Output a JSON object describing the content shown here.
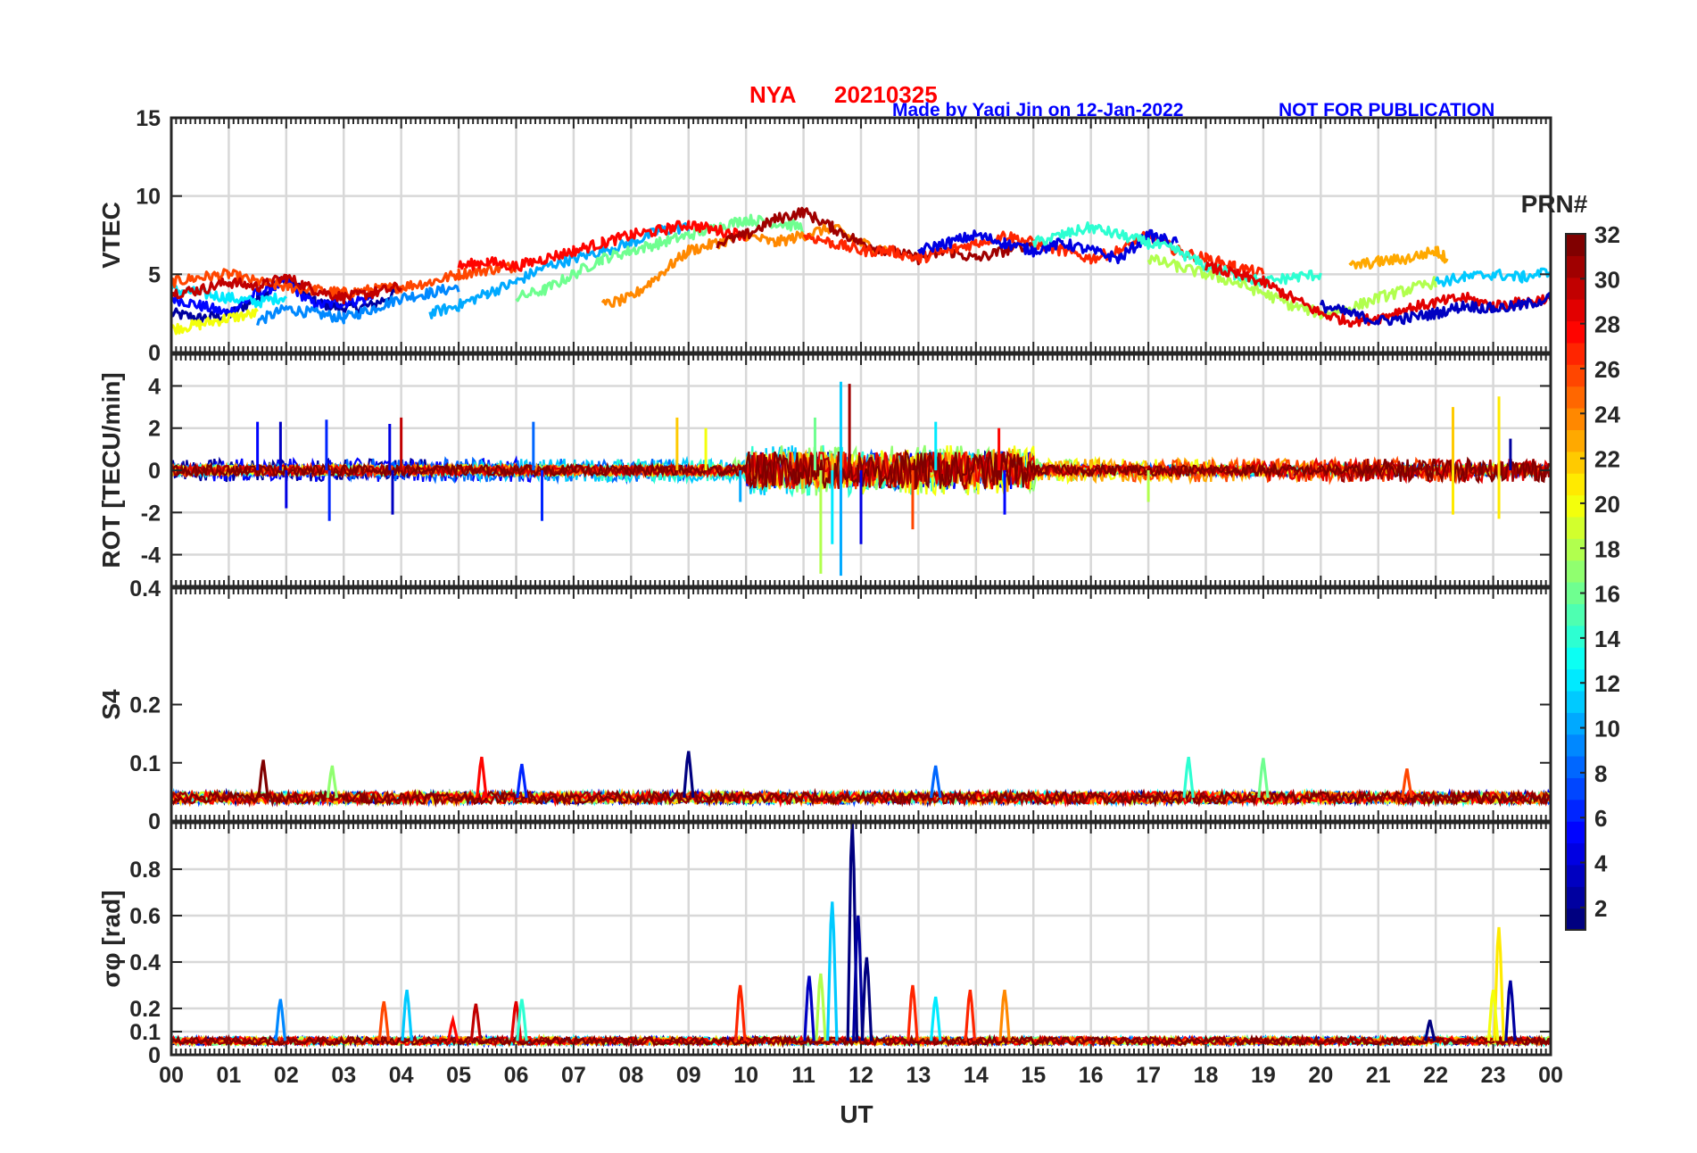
{
  "header": {
    "station": "NYA",
    "date": "20210325",
    "credit": "Made by Yaqi Jin on 12-Jan-2022",
    "notice": "NOT FOR PUBLICATION",
    "station_color": "#ff0000",
    "credit_color": "#0000ff"
  },
  "chart_data": [
    {
      "type": "line",
      "panel": "vtec",
      "ylabel": "VTEC",
      "ylim": [
        0,
        15
      ],
      "yticks": [
        0,
        5,
        10,
        15
      ],
      "ytick_labels": [
        "0",
        "5",
        "10",
        "15"
      ],
      "xlim": [
        0,
        24
      ],
      "grid": true,
      "series_note_values": "approximate envelope traces per PRN group",
      "series": [
        {
          "prn": 2,
          "x": [
            0,
            0.5,
            1,
            1.5,
            2,
            2.5,
            3,
            3.5,
            4
          ],
          "y": [
            2.5,
            2.2,
            2.4,
            3.5,
            4.8,
            3.2,
            2.8,
            3.0,
            4.0
          ]
        },
        {
          "prn": 5,
          "x": [
            0,
            0.5,
            1,
            1.5,
            2,
            2.5,
            3,
            3.5
          ],
          "y": [
            3.5,
            3.0,
            2.5,
            3.8,
            4.5,
            3.0,
            3.2,
            3.5
          ]
        },
        {
          "prn": 9,
          "x": [
            1.5,
            2,
            2.5,
            3,
            3.5,
            4,
            4.5,
            5
          ],
          "y": [
            2.0,
            2.8,
            2.5,
            2.2,
            2.8,
            3.5,
            3.8,
            4.2
          ]
        },
        {
          "prn": 12,
          "x": [
            0,
            0.5,
            1,
            1.5,
            2
          ],
          "y": [
            4.0,
            3.8,
            3.5,
            3.2,
            3.6
          ]
        },
        {
          "prn": 20,
          "x": [
            0,
            0.5,
            1,
            1.5
          ],
          "y": [
            1.5,
            1.8,
            2.2,
            2.5
          ]
        },
        {
          "prn": 26,
          "x": [
            0,
            0.5,
            1,
            1.5,
            2,
            2.5,
            3,
            3.5,
            4,
            4.5,
            5,
            5.5,
            6
          ],
          "y": [
            4.5,
            4.8,
            5.0,
            4.5,
            4.2,
            4.0,
            3.8,
            4.0,
            4.2,
            4.5,
            5.0,
            5.3,
            5.5
          ]
        },
        {
          "prn": 30,
          "x": [
            0,
            0.5,
            1,
            1.5,
            2,
            2.5,
            3,
            3.5,
            4
          ],
          "y": [
            3.8,
            4.0,
            4.5,
            4.2,
            4.8,
            4.0,
            3.5,
            3.8,
            4.2
          ]
        },
        {
          "prn": 10,
          "x": [
            4.5,
            5,
            5.5,
            6,
            6.5,
            7,
            7.5,
            8,
            8.5,
            9
          ],
          "y": [
            2.5,
            3.0,
            3.8,
            4.5,
            5.5,
            6.0,
            6.5,
            7.0,
            7.8,
            8.0
          ]
        },
        {
          "prn": 16,
          "x": [
            6,
            6.5,
            7,
            7.5,
            8,
            8.5,
            9,
            9.5,
            10,
            10.5,
            11
          ],
          "y": [
            3.5,
            4.0,
            5.0,
            6.0,
            6.5,
            7.0,
            7.5,
            8.0,
            8.5,
            8.3,
            8.0
          ]
        },
        {
          "prn": 24,
          "x": [
            7.5,
            8,
            8.5,
            9,
            9.5,
            10,
            10.5,
            11,
            11.5,
            12,
            12.5
          ],
          "y": [
            3.0,
            3.5,
            5.0,
            6.5,
            7.0,
            7.5,
            7.0,
            7.5,
            8.0,
            7.0,
            6.5
          ]
        },
        {
          "prn": 28,
          "x": [
            5,
            5.5,
            6,
            6.5,
            7,
            7.5,
            8,
            8.5,
            9,
            9.5,
            10
          ],
          "y": [
            5.5,
            5.8,
            5.5,
            6.0,
            6.5,
            7.0,
            7.5,
            7.8,
            8.2,
            7.8,
            7.5
          ]
        },
        {
          "prn": 31,
          "x": [
            9.5,
            10,
            10.5,
            11,
            11.5,
            12,
            12.5,
            13,
            13.5,
            14,
            14.5,
            15
          ],
          "y": [
            7.0,
            7.5,
            8.5,
            9.0,
            8.0,
            7.0,
            6.5,
            6.0,
            6.5,
            6.0,
            6.5,
            7.0
          ]
        },
        {
          "prn": 27,
          "x": [
            11,
            11.5,
            12,
            12.5,
            13,
            13.5,
            14,
            14.5,
            15,
            15.5,
            16,
            16.5,
            17,
            17.5,
            18,
            18.5,
            19
          ],
          "y": [
            7.5,
            7.0,
            6.5,
            6.5,
            6.0,
            6.5,
            7.0,
            7.5,
            7.0,
            6.5,
            6.0,
            6.5,
            7.5,
            6.5,
            6.0,
            5.5,
            5.0
          ]
        },
        {
          "prn": 4,
          "x": [
            13,
            13.5,
            14,
            14.5,
            15,
            15.5,
            16,
            16.5,
            17,
            17.5
          ],
          "y": [
            6.5,
            7.0,
            7.5,
            7.0,
            6.5,
            7.0,
            6.5,
            6.0,
            7.5,
            7.0
          ]
        },
        {
          "prn": 14,
          "x": [
            15,
            15.5,
            16,
            16.5,
            17,
            17.5,
            18,
            18.5,
            19,
            19.5,
            20
          ],
          "y": [
            7.0,
            7.5,
            8.0,
            7.5,
            7.0,
            6.5,
            5.5,
            5.0,
            4.5,
            4.8,
            5.0
          ]
        },
        {
          "prn": 18,
          "x": [
            17,
            17.5,
            18,
            18.5,
            19,
            19.5,
            20,
            20.5,
            21,
            21.5,
            22
          ],
          "y": [
            6.0,
            5.5,
            5.0,
            4.5,
            3.8,
            3.0,
            2.5,
            2.8,
            3.5,
            4.0,
            4.5
          ]
        },
        {
          "prn": 29,
          "x": [
            18,
            18.5,
            19,
            19.5,
            20,
            20.5,
            21,
            21.5,
            22,
            22.5,
            23,
            23.5,
            24
          ],
          "y": [
            5.5,
            5.0,
            4.5,
            3.5,
            2.5,
            2.0,
            2.2,
            2.8,
            3.2,
            3.5,
            3.0,
            3.2,
            3.5
          ]
        },
        {
          "prn": 3,
          "x": [
            20,
            20.5,
            21,
            21.5,
            22,
            22.5,
            23,
            23.5,
            24
          ],
          "y": [
            3.0,
            2.5,
            2.0,
            2.2,
            2.5,
            3.0,
            2.8,
            3.0,
            3.5
          ]
        },
        {
          "prn": 23,
          "x": [
            20.5,
            21,
            21.5,
            22,
            22.2
          ],
          "y": [
            5.5,
            5.8,
            6.0,
            6.5,
            6.0
          ]
        },
        {
          "prn": 11,
          "x": [
            22,
            22.5,
            23,
            23.5,
            24
          ],
          "y": [
            4.5,
            4.8,
            5.0,
            4.8,
            5.2
          ]
        }
      ]
    },
    {
      "type": "line",
      "panel": "rot",
      "ylabel": "ROT [TECU/min]",
      "ylim": [
        -5.5,
        5.5
      ],
      "yticks": [
        -4,
        -2,
        0,
        2,
        4
      ],
      "ytick_labels": [
        "-4",
        "-2",
        "0",
        "2",
        "4"
      ],
      "xlim": [
        0,
        24
      ],
      "grid": true,
      "spikes": [
        {
          "prn": 5,
          "x": 1.5,
          "y": 2.3
        },
        {
          "prn": 3,
          "x": 1.9,
          "y": 2.3
        },
        {
          "prn": 4,
          "x": 2.0,
          "y": -1.8
        },
        {
          "prn": 6,
          "x": 2.7,
          "y": 2.4
        },
        {
          "prn": 6,
          "x": 2.75,
          "y": -2.4
        },
        {
          "prn": 4,
          "x": 3.8,
          "y": 2.2
        },
        {
          "prn": 3,
          "x": 3.85,
          "y": -2.1
        },
        {
          "prn": 30,
          "x": 4.0,
          "y": 2.5
        },
        {
          "prn": 8,
          "x": 6.3,
          "y": 2.3
        },
        {
          "prn": 6,
          "x": 6.45,
          "y": -2.4
        },
        {
          "prn": 22,
          "x": 8.8,
          "y": 2.5
        },
        {
          "prn": 20,
          "x": 9.3,
          "y": 2.0
        },
        {
          "prn": 10,
          "x": 9.9,
          "y": -1.5
        },
        {
          "prn": 18,
          "x": 11.3,
          "y": -4.9
        },
        {
          "prn": 12,
          "x": 11.5,
          "y": -3.5
        },
        {
          "prn": 11,
          "x": 11.65,
          "y": 4.2
        },
        {
          "prn": 10,
          "x": 11.65,
          "y": -5.0
        },
        {
          "prn": 31,
          "x": 11.8,
          "y": 4.1
        },
        {
          "prn": 4,
          "x": 12.0,
          "y": -3.5
        },
        {
          "prn": 16,
          "x": 11.2,
          "y": 2.5
        },
        {
          "prn": 26,
          "x": 12.9,
          "y": -2.8
        },
        {
          "prn": 12,
          "x": 13.3,
          "y": 2.3
        },
        {
          "prn": 5,
          "x": 14.5,
          "y": -2.1
        },
        {
          "prn": 28,
          "x": 14.4,
          "y": 2.0
        },
        {
          "prn": 18,
          "x": 17.0,
          "y": -1.5
        },
        {
          "prn": 22,
          "x": 22.3,
          "y": 3.0
        },
        {
          "prn": 21,
          "x": 22.3,
          "y": -2.1
        },
        {
          "prn": 21,
          "x": 23.1,
          "y": 3.5
        },
        {
          "prn": 21,
          "x": 23.1,
          "y": -2.3
        },
        {
          "prn": 2,
          "x": 23.3,
          "y": 1.5
        }
      ]
    },
    {
      "type": "line",
      "panel": "s4",
      "ylabel": "S4",
      "ylim": [
        0,
        0.4
      ],
      "yticks": [
        0,
        0.1,
        0.2,
        0.4
      ],
      "ytick_labels": [
        "0",
        "0.1",
        "0.2",
        "0.4"
      ],
      "xlim": [
        0,
        24
      ],
      "grid": false,
      "baseline": 0.04,
      "peaks": [
        {
          "prn": 32,
          "x": 1.6,
          "y": 0.105
        },
        {
          "prn": 17,
          "x": 2.8,
          "y": 0.095
        },
        {
          "prn": 28,
          "x": 5.4,
          "y": 0.11
        },
        {
          "prn": 6,
          "x": 6.1,
          "y": 0.098
        },
        {
          "prn": 1,
          "x": 9.0,
          "y": 0.12
        },
        {
          "prn": 8,
          "x": 13.3,
          "y": 0.095
        },
        {
          "prn": 14,
          "x": 17.7,
          "y": 0.11
        },
        {
          "prn": 16,
          "x": 19.0,
          "y": 0.108
        },
        {
          "prn": 26,
          "x": 21.5,
          "y": 0.09
        }
      ]
    },
    {
      "type": "line",
      "panel": "sigma_phi",
      "ylabel": "σφ [rad]",
      "ylim": [
        0,
        1.0
      ],
      "yticks": [
        0,
        0.1,
        0.2,
        0.4,
        0.6,
        0.8
      ],
      "ytick_labels": [
        "0",
        "0.1",
        "0.2",
        "0.4",
        "0.6",
        "0.8"
      ],
      "xlim": [
        0,
        24
      ],
      "grid": true,
      "baseline": 0.06,
      "peaks": [
        {
          "prn": 9,
          "x": 1.9,
          "y": 0.24
        },
        {
          "prn": 26,
          "x": 3.7,
          "y": 0.23
        },
        {
          "prn": 11,
          "x": 4.1,
          "y": 0.28
        },
        {
          "prn": 28,
          "x": 4.9,
          "y": 0.15
        },
        {
          "prn": 30,
          "x": 5.3,
          "y": 0.22
        },
        {
          "prn": 29,
          "x": 6.0,
          "y": 0.23
        },
        {
          "prn": 14,
          "x": 6.1,
          "y": 0.24
        },
        {
          "prn": 27,
          "x": 9.9,
          "y": 0.3
        },
        {
          "prn": 18,
          "x": 11.3,
          "y": 0.35
        },
        {
          "prn": 3,
          "x": 11.1,
          "y": 0.34
        },
        {
          "prn": 11,
          "x": 11.5,
          "y": 0.66
        },
        {
          "prn": 1,
          "x": 11.85,
          "y": 1.0
        },
        {
          "prn": 2,
          "x": 11.95,
          "y": 0.6
        },
        {
          "prn": 1,
          "x": 12.1,
          "y": 0.42
        },
        {
          "prn": 27,
          "x": 12.9,
          "y": 0.3
        },
        {
          "prn": 12,
          "x": 13.3,
          "y": 0.25
        },
        {
          "prn": 27,
          "x": 13.9,
          "y": 0.28
        },
        {
          "prn": 24,
          "x": 14.5,
          "y": 0.28
        },
        {
          "prn": 21,
          "x": 23.1,
          "y": 0.55
        },
        {
          "prn": 20,
          "x": 23.0,
          "y": 0.28
        },
        {
          "prn": 2,
          "x": 23.3,
          "y": 0.32
        },
        {
          "prn": 1,
          "x": 21.9,
          "y": 0.15
        }
      ]
    }
  ],
  "xaxis": {
    "label": "UT",
    "ticks": [
      "00",
      "01",
      "02",
      "03",
      "04",
      "05",
      "06",
      "07",
      "08",
      "09",
      "10",
      "11",
      "12",
      "13",
      "14",
      "15",
      "16",
      "17",
      "18",
      "19",
      "20",
      "21",
      "22",
      "23",
      "00"
    ]
  },
  "colorbar": {
    "title": "PRN#",
    "range": [
      1,
      32
    ],
    "ticks": [
      "2",
      "4",
      "6",
      "8",
      "10",
      "12",
      "14",
      "16",
      "18",
      "20",
      "22",
      "24",
      "26",
      "28",
      "30",
      "32"
    ],
    "colormap": "jet"
  }
}
